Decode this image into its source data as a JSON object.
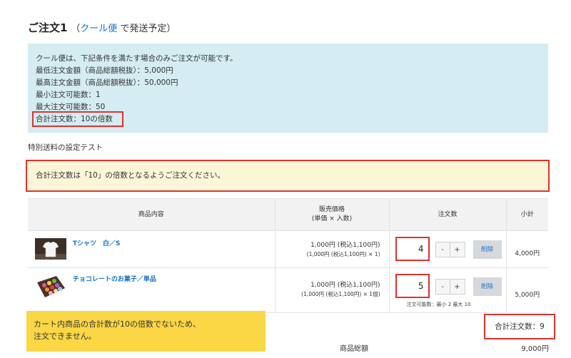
{
  "order": {
    "title": "ご注文1",
    "paren_open": "（",
    "method_link": "クール便",
    "method_suffix": " で発送予定）"
  },
  "conditions": {
    "lines": [
      "クール便は、下記条件を満たす場合のみご注文が可能です。",
      "最低注文金額（商品総額税抜）：5,000円",
      "最高注文金額（商品総額税抜）：50,000円",
      "最小注文可能数：1",
      "最大注文可能数：50",
      "合計注文数：10の倍数"
    ]
  },
  "shipping_note": "特別送料の設定テスト",
  "warning": "合計注文数は「10」の倍数となるようご注文ください。",
  "table": {
    "headers": {
      "product": "商品内容",
      "price_line1": "販売価格",
      "price_line2": "(単価 × 入数)",
      "qty": "注文数",
      "subtotal": "小計"
    },
    "rows": [
      {
        "name": "Tシャツ　白／S",
        "image_icon": "tshirt-image",
        "price_main": "1,000円 (税込1,100円)",
        "price_sub": "(1,000円 (税込1,100円) × 1)",
        "qty": "4",
        "minus": "-",
        "plus": "+",
        "delete": "削除",
        "hint": "",
        "subtotal": "4,000円"
      },
      {
        "name": "チョコレートのお菓子／単品",
        "image_icon": "chocolate-box-image",
        "price_main": "1,000円 (税込1,100円)",
        "price_sub": "(1,000円 (税込1,100円) × 1個)",
        "qty": "5",
        "minus": "-",
        "plus": "+",
        "delete": "削除",
        "hint": "注文可能数：最小 2  最大 10",
        "subtotal": "5,000円"
      }
    ]
  },
  "error_message": {
    "line1": "カート内商品の合計数が10の倍数でないため、",
    "line2": "注文できません。"
  },
  "total_qty": "合計注文数：9",
  "grand_total": {
    "label": "商品総額",
    "value": "9,000円"
  },
  "colors": {
    "highlight": "#e0322d",
    "info_bg": "#d4ecf2",
    "warning_bg": "#fcf5d8",
    "popup_bg": "#fbd645",
    "link": "#1a73c8"
  }
}
